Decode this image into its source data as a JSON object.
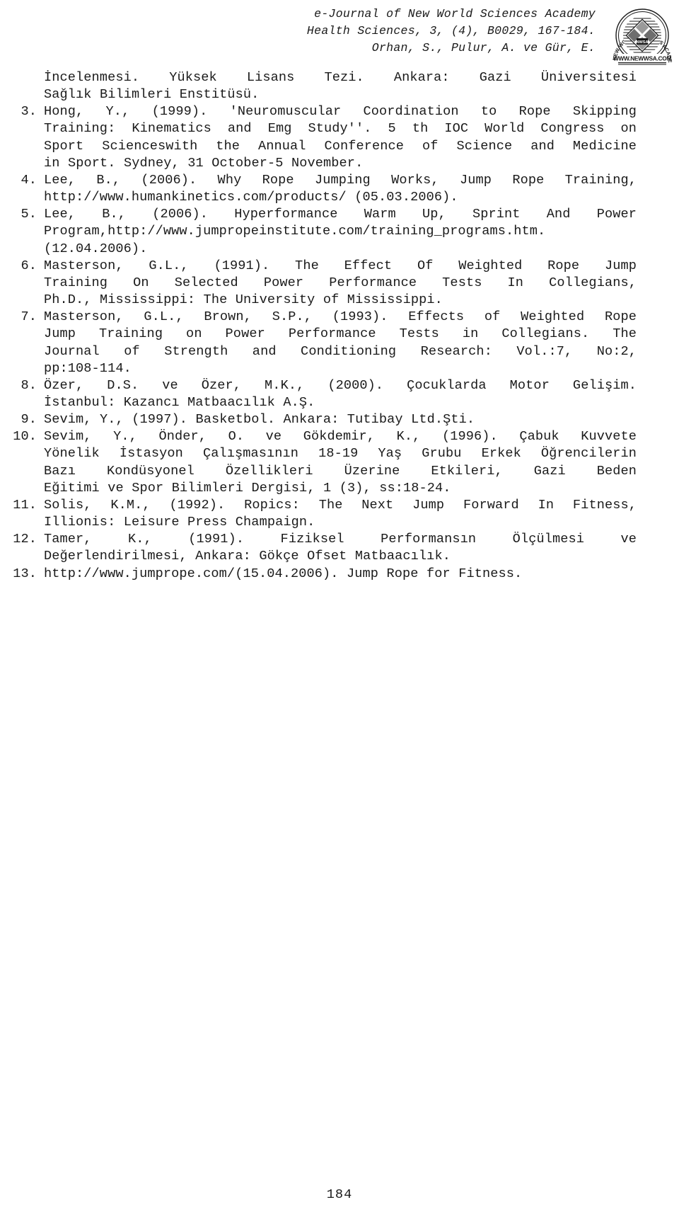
{
  "header": {
    "line1": "e-Journal of New World Sciences Academy",
    "line2": "Health Sciences, 3, (4), B0029, 167-184.",
    "line3": "Orhan, S., Pulur, A. ve Gür, E.",
    "logo_outer_text": "NEW WORLD SCIENCES ACADEMY",
    "logo_inner_text": "NWSA",
    "logo_url_text": "WWW.NEWWSA.COM"
  },
  "continued_reference": {
    "line1": "İncelenmesi. Yüksek Lisans Tezi. Ankara: Gazi Üniversitesi",
    "line2": "Sağlık Bilimleri Enstitüsü."
  },
  "references": [
    {
      "number": "3.",
      "lines": [
        "Hong, Y., (1999). ʹNeuromuscular Coordination to Rope Skipping",
        "Training: Kinematics and Emg Studyʹʹ. 5 th IOC World Congress on",
        "Sport Scienceswith the Annual Conference of Science and Medicine",
        "in Sport. Sydney, 31 October-5 November."
      ]
    },
    {
      "number": "4.",
      "lines": [
        "Lee, B., (2006). Why Rope Jumping Works, Jump Rope Training,",
        "http://www.humankinetics.com/products/ (05.03.2006)."
      ]
    },
    {
      "number": "5.",
      "lines": [
        "Lee, B., (2006). Hyperformance Warm Up, Sprint And Power",
        "Program,http://www.jumpropeinstitute.com/training_programs.htm.",
        "(12.04.2006)."
      ]
    },
    {
      "number": "6.",
      "lines": [
        "Masterson, G.L., (1991). The Effect Of Weighted Rope Jump",
        "Training On Selected Power Performance Tests In Collegians,",
        "Ph.D., Mississippi: The University of Mississippi."
      ]
    },
    {
      "number": "7.",
      "lines": [
        "Masterson, G.L., Brown, S.P., (1993). Effects of Weighted Rope",
        "Jump Training on Power Performance Tests in Collegians. The",
        "Journal of Strength and Conditioning Research: Vol.:7, No:2,",
        "pp:108-114."
      ]
    },
    {
      "number": "8.",
      "lines": [
        "Özer, D.S. ve Özer, M.K., (2000). Çocuklarda Motor Gelişim.",
        "İstanbul: Kazancı Matbaacılık A.Ş."
      ]
    },
    {
      "number": "9.",
      "lines": [
        "Sevim, Y., (1997). Basketbol. Ankara: Tutibay Ltd.Şti."
      ]
    },
    {
      "number": "10.",
      "lines": [
        "Sevim, Y., Önder, O. ve Gökdemir, K., (1996). Çabuk Kuvvete",
        "Yönelik İstasyon Çalışmasının 18-19 Yaş Grubu Erkek Öğrencilerin",
        "Bazı Kondüsyonel Özellikleri Üzerine Etkileri, Gazi Beden",
        "Eğitimi ve Spor Bilimleri Dergisi, 1 (3), ss:18-24."
      ]
    },
    {
      "number": "11.",
      "lines": [
        "Solis, K.M., (1992). Ropics: The Next Jump Forward In Fitness,",
        "Illionis: Leisure Press Champaign."
      ]
    },
    {
      "number": "12.",
      "lines": [
        "Tamer, K., (1991). Fiziksel Performansın Ölçülmesi ve",
        "Değerlendirilmesi, Ankara: Gökçe Ofset Matbaacılık."
      ]
    },
    {
      "number": "13.",
      "lines": [
        "http://www.jumprope.com/(15.04.2006). Jump Rope for Fitness."
      ]
    }
  ],
  "footer": {
    "page_number": "184"
  }
}
